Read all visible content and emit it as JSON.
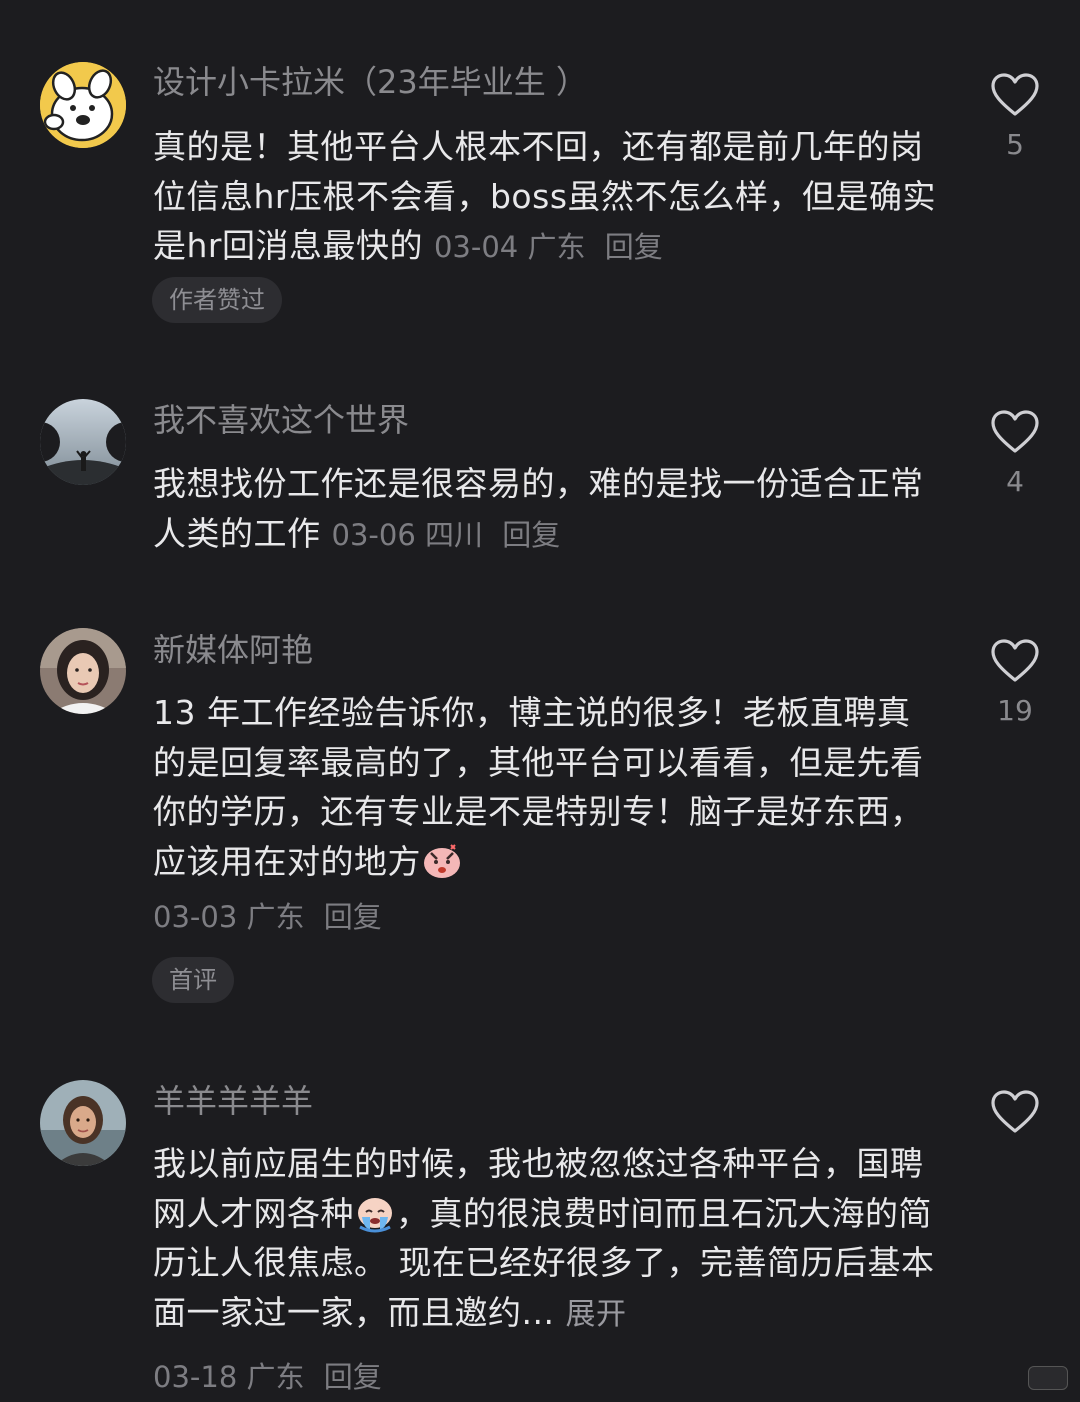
{
  "comments": [
    {
      "username": "设计小卡拉米（23年毕业生 ）",
      "text": "真的是！其他平台人根本不回，还有都是前几年的岗位信息hr压根不会看，boss虽然不怎么样，但是确实是hr回消息最快的",
      "date": "03-04",
      "location": "广东",
      "reply_label": "回复",
      "badge": "作者赞过",
      "likes": "5",
      "avatar_icon": "cartoon-dog-avatar-icon"
    },
    {
      "username": "我不喜欢这个世界",
      "text": "我想找份工作还是很容易的，难的是找一份适合正常人类的工作",
      "date": "03-06",
      "location": "四川",
      "reply_label": "回复",
      "likes": "4",
      "avatar_icon": "person-on-hill-avatar-icon"
    },
    {
      "username": "新媒体阿艳",
      "text": "13 年工作经验告诉你，博主说的很多！老板直聘真的是回复率最高的了，其他平台可以看看，但是先看你的学历，还有专业是不是特别专！脑子是好东西，应该用在对的地方",
      "date": "03-03",
      "location": "广东",
      "reply_label": "回复",
      "badge": "首评",
      "likes": "19",
      "avatar_icon": "woman-portrait-avatar-icon",
      "emoji": "angry-face-emoji-icon"
    },
    {
      "username": "羊羊羊羊羊",
      "text_part1": "我以前应届生的时候，我也被忽悠过各种平台，国聘网人才网各种",
      "text_part2": "，真的很浪费时间而且石沉大海的简历让人很焦虑。  现在已经好很多了，完善简历后基本面一家过一家，而且邀约...",
      "expand_label": "展开",
      "date": "03-18",
      "location": "广东",
      "reply_label": "回复",
      "likes": "",
      "avatar_icon": "woman-beach-avatar-icon",
      "emoji": "crying-face-emoji-icon"
    }
  ],
  "icons": {
    "like": "heart-outline-icon"
  },
  "colors": {
    "background": "#1c1c1f",
    "text": "#e8e8ea",
    "muted": "#8a8a8e",
    "badge_bg": "#2d2d31"
  }
}
